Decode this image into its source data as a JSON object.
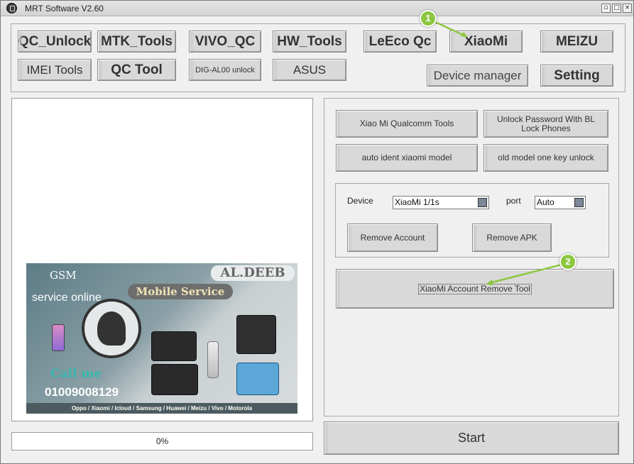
{
  "window": {
    "title": "MRT Software V2.60"
  },
  "top_buttons": {
    "qc_unlock": "QC_Unlock",
    "mtk_tools": "MTK_Tools",
    "vivo_qc": "VIVO_QC",
    "hw_tools": "HW_Tools",
    "leeco_qc": "LeEco Qc",
    "xiaomi": "XiaoMi",
    "meizu": "MEIZU",
    "imei_tools": "IMEI Tools",
    "qc_tool": "QC Tool",
    "dig_al00": "DIG-AL00 unlock",
    "asus": "ASUS",
    "device_manager": "Device manager",
    "setting": "Setting"
  },
  "xiaomi_panel": {
    "qualcomm_tools": "Xiao Mi Qualcomm Tools",
    "unlock_password": "Unlock Password With BL Lock Phones",
    "auto_ident": "auto ident xiaomi model",
    "old_model": "old model one key unlock",
    "device_label": "Device",
    "device_value": "XiaoMi 1/1s",
    "port_label": "port",
    "port_value": "Auto",
    "remove_account": "Remove Account",
    "remove_apk": "Remove APK",
    "account_remove_tool": "XiaoMi Account Remove Tool"
  },
  "ad": {
    "gsm": "GSM",
    "brand": "AL.DEEB",
    "service_online": "service online",
    "mobile_service": "Mobile Service",
    "call_me": "Call me",
    "phone": "01009008129",
    "footer": "Oppo / Xiaomi / Icloud / Samsung / Huawei / Meizu / Vivo / Motorola"
  },
  "progress": {
    "value": 0,
    "label": "0%"
  },
  "start_button": "Start",
  "callouts": {
    "one": "1",
    "two": "2"
  },
  "colors": {
    "callout_green": "#8dc63f",
    "window_bg": "#f0f0f0"
  }
}
